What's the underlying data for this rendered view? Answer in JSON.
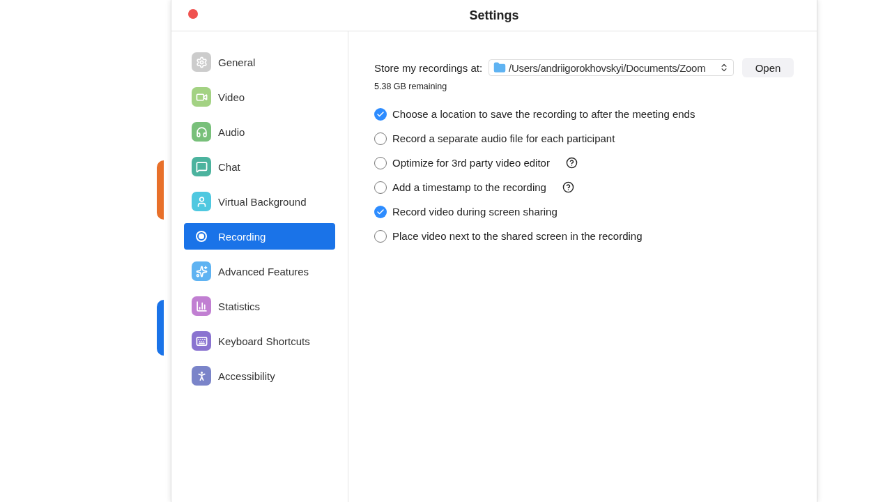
{
  "window": {
    "title": "Settings"
  },
  "sidebar": {
    "items": [
      {
        "label": "General",
        "kind": "gear",
        "color": "#cccccc",
        "selected": false
      },
      {
        "label": "Video",
        "kind": "camera",
        "color": "#a3d283",
        "selected": false
      },
      {
        "label": "Audio",
        "kind": "headphones",
        "color": "#78c07a",
        "selected": false
      },
      {
        "label": "Chat",
        "kind": "chat",
        "color": "#4bb39e",
        "selected": false
      },
      {
        "label": "Virtual Background",
        "kind": "person",
        "color": "#4fc8e0",
        "selected": false
      },
      {
        "label": "Recording",
        "kind": "record",
        "color": "#1a73e8",
        "selected": true
      },
      {
        "label": "Advanced Features",
        "kind": "sparkles",
        "color": "#5fb3f2",
        "selected": false
      },
      {
        "label": "Statistics",
        "kind": "bars",
        "color": "#c17fd2",
        "selected": false
      },
      {
        "label": "Keyboard Shortcuts",
        "kind": "keyboard",
        "color": "#8a73d0",
        "selected": false
      },
      {
        "label": "Accessibility",
        "kind": "accessibility",
        "color": "#7a84c9",
        "selected": false
      }
    ]
  },
  "storage": {
    "label": "Store my recordings at:",
    "path": "/Users/andriigorokhovskyi/Documents/Zoom",
    "button": "Open",
    "remaining": "5.38 GB remaining"
  },
  "options": [
    {
      "label": "Choose a location to save the recording to after the meeting ends",
      "checked": true,
      "help": false
    },
    {
      "label": "Record a separate audio file for each participant",
      "checked": false,
      "help": false
    },
    {
      "label": "Optimize for 3rd party video editor",
      "checked": false,
      "help": true
    },
    {
      "label": "Add a timestamp to the recording",
      "checked": false,
      "help": true
    },
    {
      "label": "Record video during screen sharing",
      "checked": true,
      "help": false
    },
    {
      "label": "Place video next to the shared screen in the recording",
      "checked": false,
      "help": false
    }
  ]
}
